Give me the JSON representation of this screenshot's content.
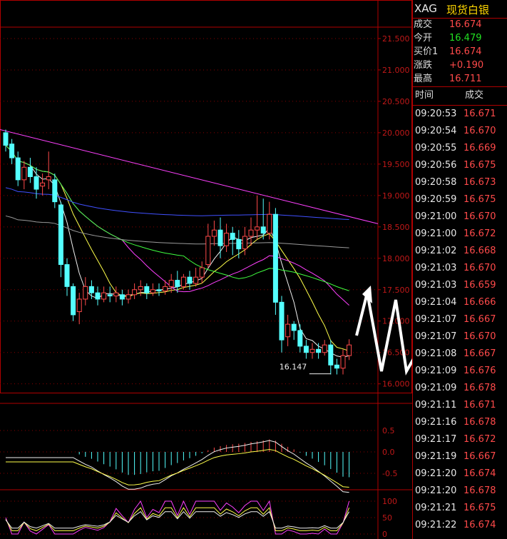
{
  "symbol": "XAG",
  "symbol_name": "现货白银",
  "quote": [
    {
      "label": "成交",
      "value": "16.674",
      "color": "#ff4a4a"
    },
    {
      "label": "今开",
      "value": "16.479",
      "color": "#22e022"
    },
    {
      "label": "买价1",
      "value": "16.674",
      "color": "#ff4a4a"
    },
    {
      "label": "涨跌",
      "value": "+0.190",
      "color": "#ff4a4a"
    },
    {
      "label": "最高",
      "value": "16.711",
      "color": "#ff4a4a"
    }
  ],
  "ticks_header": {
    "time": "时间",
    "price": "成交"
  },
  "ticks": [
    {
      "time": "09:20:53",
      "price": "16.671"
    },
    {
      "time": "09:20:54",
      "price": "16.670"
    },
    {
      "time": "09:20:55",
      "price": "16.669"
    },
    {
      "time": "09:20:56",
      "price": "16.675"
    },
    {
      "time": "09:20:58",
      "price": "16.673"
    },
    {
      "time": "09:20:59",
      "price": "16.675"
    },
    {
      "time": "09:21:00",
      "price": "16.670"
    },
    {
      "time": "09:21:00",
      "price": "16.672"
    },
    {
      "time": "09:21:02",
      "price": "16.668"
    },
    {
      "time": "09:21:03",
      "price": "16.670"
    },
    {
      "time": "09:21:03",
      "price": "16.659"
    },
    {
      "time": "09:21:04",
      "price": "16.666"
    },
    {
      "time": "09:21:07",
      "price": "16.667"
    },
    {
      "time": "09:21:07",
      "price": "16.670"
    },
    {
      "time": "09:21:08",
      "price": "16.667"
    },
    {
      "time": "09:21:09",
      "price": "16.676"
    },
    {
      "time": "09:21:09",
      "price": "16.678"
    },
    {
      "time": "09:21:11",
      "price": "16.671"
    },
    {
      "time": "09:21:16",
      "price": "16.678"
    },
    {
      "time": "09:21:17",
      "price": "16.672"
    },
    {
      "time": "09:21:19",
      "price": "16.667"
    },
    {
      "time": "09:21:20",
      "price": "16.674"
    },
    {
      "time": "09:21:20",
      "price": "16.678"
    },
    {
      "time": "09:21:21",
      "price": "16.675"
    },
    {
      "time": "09:21:22",
      "price": "16.674"
    }
  ],
  "chart_data": {
    "type": "candlestick",
    "price_axis": {
      "ticks": [
        "21.500",
        "21.000",
        "20.500",
        "20.000",
        "19.500",
        "19.000",
        "18.500",
        "18.000",
        "17.500",
        "17.000",
        "16.500",
        "16.000"
      ],
      "ylim": [
        15.86,
        22.0
      ]
    },
    "annotation": "16.147",
    "up_color": "#ff4a4a",
    "down_color": "#54ffff",
    "candles": [
      [
        20.0,
        19.8,
        20.05,
        19.7
      ],
      [
        19.82,
        19.6,
        19.9,
        19.5
      ],
      [
        19.6,
        19.25,
        19.7,
        19.15
      ],
      [
        19.25,
        19.45,
        19.55,
        19.1
      ],
      [
        19.45,
        19.3,
        19.6,
        19.2
      ],
      [
        19.3,
        19.1,
        19.45,
        18.95
      ],
      [
        19.15,
        19.2,
        19.35,
        19.0
      ],
      [
        19.25,
        19.3,
        19.7,
        19.1
      ],
      [
        19.25,
        18.9,
        19.35,
        18.8
      ],
      [
        18.85,
        17.9,
        18.9,
        17.7
      ],
      [
        17.9,
        17.55,
        18.0,
        17.4
      ],
      [
        17.55,
        17.1,
        17.6,
        17.0
      ],
      [
        17.15,
        17.35,
        17.45,
        16.95
      ],
      [
        17.35,
        17.55,
        17.7,
        17.25
      ],
      [
        17.55,
        17.45,
        17.65,
        17.35
      ],
      [
        17.45,
        17.35,
        17.55,
        17.25
      ],
      [
        17.35,
        17.45,
        17.55,
        17.3
      ],
      [
        17.42,
        17.4,
        17.55,
        17.3
      ],
      [
        17.4,
        17.45,
        17.55,
        17.3
      ],
      [
        17.42,
        17.35,
        17.5,
        17.25
      ],
      [
        17.35,
        17.42,
        17.5,
        17.28
      ],
      [
        17.42,
        17.5,
        17.6,
        17.35
      ],
      [
        17.5,
        17.55,
        17.65,
        17.4
      ],
      [
        17.55,
        17.45,
        17.6,
        17.35
      ],
      [
        17.45,
        17.5,
        17.6,
        17.4
      ],
      [
        17.5,
        17.48,
        17.6,
        17.4
      ],
      [
        17.48,
        17.55,
        17.65,
        17.42
      ],
      [
        17.55,
        17.65,
        17.75,
        17.45
      ],
      [
        17.65,
        17.55,
        17.8,
        17.45
      ],
      [
        17.55,
        17.7,
        17.75,
        17.5
      ],
      [
        17.7,
        17.6,
        17.8,
        17.5
      ],
      [
        17.6,
        17.7,
        17.85,
        17.55
      ],
      [
        17.7,
        17.85,
        17.95,
        17.6
      ],
      [
        17.9,
        18.35,
        18.55,
        17.85
      ],
      [
        18.35,
        18.45,
        18.6,
        18.2
      ],
      [
        18.45,
        18.2,
        18.65,
        18.0
      ],
      [
        18.2,
        18.4,
        18.55,
        18.1
      ],
      [
        18.4,
        18.3,
        18.5,
        18.05
      ],
      [
        18.3,
        18.15,
        18.45,
        18.0
      ],
      [
        18.15,
        18.35,
        18.5,
        18.05
      ],
      [
        18.35,
        18.45,
        18.65,
        18.2
      ],
      [
        18.45,
        18.5,
        19.0,
        18.3
      ],
      [
        18.5,
        18.4,
        18.95,
        18.3
      ],
      [
        18.4,
        18.7,
        18.9,
        18.3
      ],
      [
        18.7,
        17.3,
        18.8,
        17.1
      ],
      [
        17.3,
        16.7,
        17.4,
        16.5
      ],
      [
        16.75,
        16.95,
        17.1,
        16.6
      ],
      [
        16.95,
        16.85,
        17.0,
        16.7
      ],
      [
        16.85,
        16.6,
        16.95,
        16.5
      ],
      [
        16.6,
        16.5,
        16.7,
        16.4
      ],
      [
        16.5,
        16.55,
        16.65,
        16.4
      ],
      [
        16.55,
        16.5,
        16.65,
        16.4
      ],
      [
        16.5,
        16.62,
        16.7,
        16.45
      ],
      [
        16.62,
        16.3,
        16.7,
        16.15
      ],
      [
        16.3,
        16.25,
        16.4,
        16.15
      ],
      [
        16.25,
        16.45,
        16.55,
        16.15
      ],
      [
        16.45,
        16.62,
        16.71,
        16.38
      ]
    ],
    "indicator_axis_1": {
      "ticks": [
        "0.5",
        "0.0",
        "-0.5"
      ]
    },
    "indicator_axis_2": {
      "ticks": [
        "100",
        "50",
        "0"
      ]
    }
  }
}
